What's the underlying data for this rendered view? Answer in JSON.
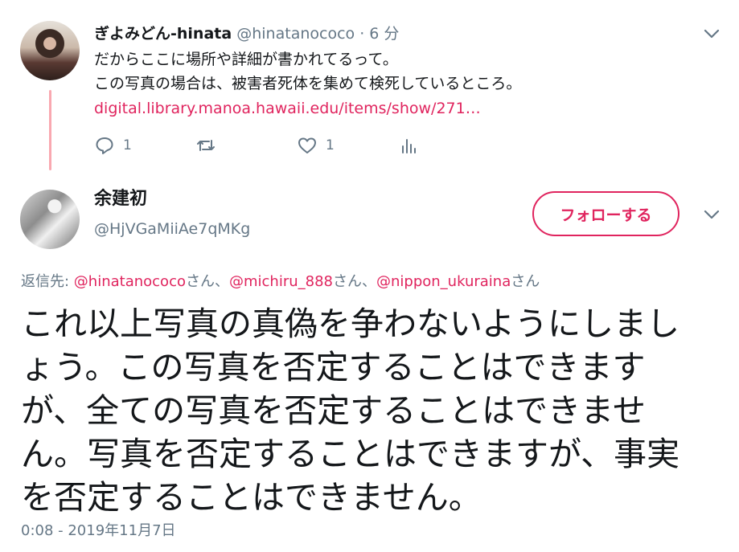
{
  "parent_tweet": {
    "display_name": "ぎよみどん-hinata",
    "handle": "@hinatanococo",
    "separator": "·",
    "time": "6 分",
    "lines": [
      "だからここに場所や詳細が書かれてるって。",
      "この写真の場合は、被害者死体を集めて検死しているところ。"
    ],
    "link": "digital.library.manoa.hawaii.edu/items/show/271…",
    "actions": {
      "reply_count": "1",
      "retweet_count": "",
      "like_count": "1"
    }
  },
  "focused_tweet": {
    "display_name": "余建初",
    "handle": "@HjVGaMiiAe7qMKg",
    "follow_label": "フォローする",
    "reply_to": {
      "prefix": "返信先: ",
      "mentions": [
        "@hinatanococo",
        "@michiru_888",
        "@nippon_ukuraina"
      ],
      "suffix": "さん",
      "separator": "、"
    },
    "text_lines": [
      "これ以上写真の真偽を争わないようにしまし",
      "ょう。この写真を否定することはできます",
      "が、全ての写真を否定することはできませ",
      "ん。写真を否定することはできますが、事実",
      "を否定することはできません。"
    ],
    "timestamp": "0:08 - 2019年11月7日"
  },
  "colors": {
    "accent": "#e0245e",
    "muted": "#657786",
    "text": "#14171a",
    "thread_line": "#f9a8b0"
  },
  "icons": {
    "reply": "reply-icon",
    "retweet": "retweet-icon",
    "like": "heart-icon",
    "analytics": "analytics-icon",
    "more": "chevron-down-icon"
  }
}
